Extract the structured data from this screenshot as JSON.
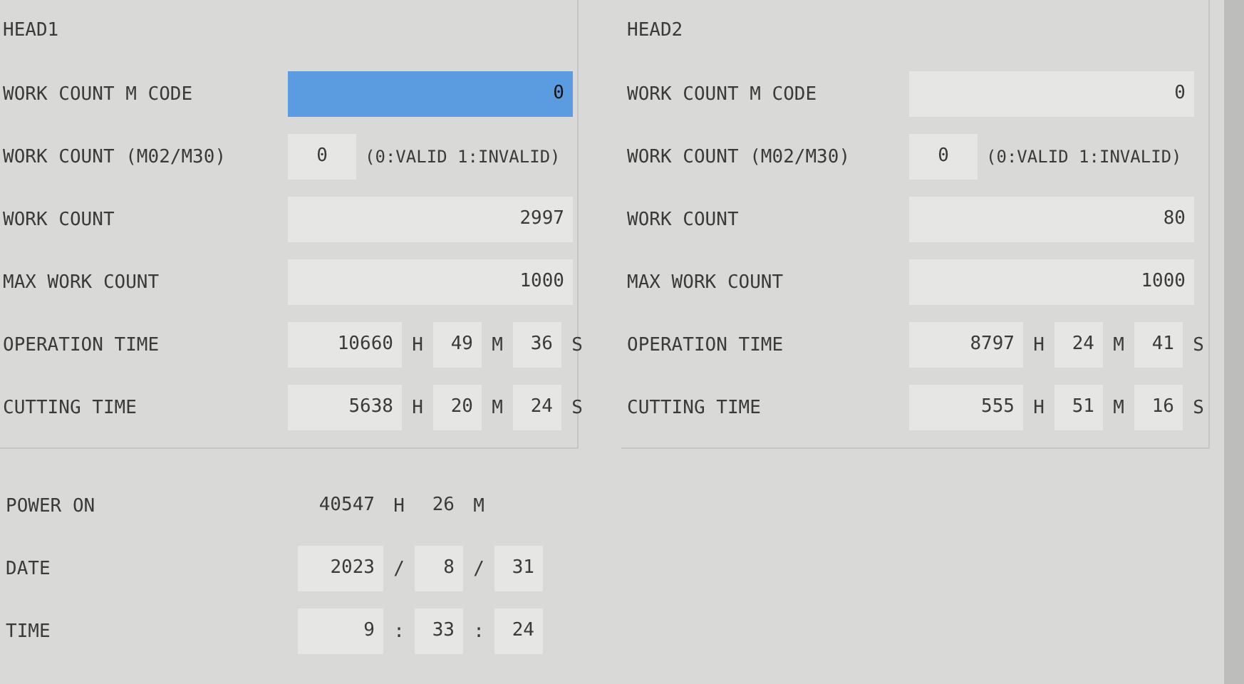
{
  "heads": [
    {
      "title": "HEAD1",
      "rows": [
        {
          "kind": "value",
          "label": "WORK COUNT M CODE",
          "value": "0",
          "selected": true
        },
        {
          "kind": "flag",
          "label": "WORK COUNT (M02/M30)",
          "value": "0",
          "note": "(0:VALID 1:INVALID)"
        },
        {
          "kind": "value",
          "label": "WORK COUNT",
          "value": "2997",
          "selected": false
        },
        {
          "kind": "value",
          "label": "MAX WORK COUNT",
          "value": "1000",
          "selected": false
        },
        {
          "kind": "hms",
          "label": "OPERATION TIME",
          "parts": [
            {
              "value": "10660",
              "unit": "H"
            },
            {
              "value": "49",
              "unit": "M"
            },
            {
              "value": "36",
              "unit": "S"
            }
          ]
        },
        {
          "kind": "hms",
          "label": "CUTTING TIME",
          "parts": [
            {
              "value": "5638",
              "unit": "H"
            },
            {
              "value": "20",
              "unit": "M"
            },
            {
              "value": "24",
              "unit": "S"
            }
          ]
        }
      ]
    },
    {
      "title": "HEAD2",
      "rows": [
        {
          "kind": "value",
          "label": "WORK COUNT M CODE",
          "value": "0",
          "selected": false
        },
        {
          "kind": "flag",
          "label": "WORK COUNT (M02/M30)",
          "value": "0",
          "note": "(0:VALID 1:INVALID)"
        },
        {
          "kind": "value",
          "label": "WORK COUNT",
          "value": "80",
          "selected": false
        },
        {
          "kind": "value",
          "label": "MAX WORK COUNT",
          "value": "1000",
          "selected": false
        },
        {
          "kind": "hms",
          "label": "OPERATION TIME",
          "parts": [
            {
              "value": "8797",
              "unit": "H"
            },
            {
              "value": "24",
              "unit": "M"
            },
            {
              "value": "41",
              "unit": "S"
            }
          ]
        },
        {
          "kind": "hms",
          "label": "CUTTING TIME",
          "parts": [
            {
              "value": "555",
              "unit": "H"
            },
            {
              "value": "51",
              "unit": "M"
            },
            {
              "value": "16",
              "unit": "S"
            }
          ]
        }
      ]
    }
  ],
  "system": [
    {
      "kind": "plain",
      "label": "POWER ON",
      "parts": [
        {
          "value": "40547",
          "unit": "H"
        },
        {
          "value": "26",
          "unit": "M"
        }
      ]
    },
    {
      "kind": "boxed",
      "label": "DATE",
      "parts": [
        {
          "value": "2023",
          "unit": "/"
        },
        {
          "value": "8",
          "unit": "/"
        },
        {
          "value": "31"
        }
      ]
    },
    {
      "kind": "boxed",
      "label": "TIME",
      "parts": [
        {
          "value": "9",
          "unit": ":"
        },
        {
          "value": "33",
          "unit": ":"
        },
        {
          "value": "24"
        }
      ]
    }
  ]
}
